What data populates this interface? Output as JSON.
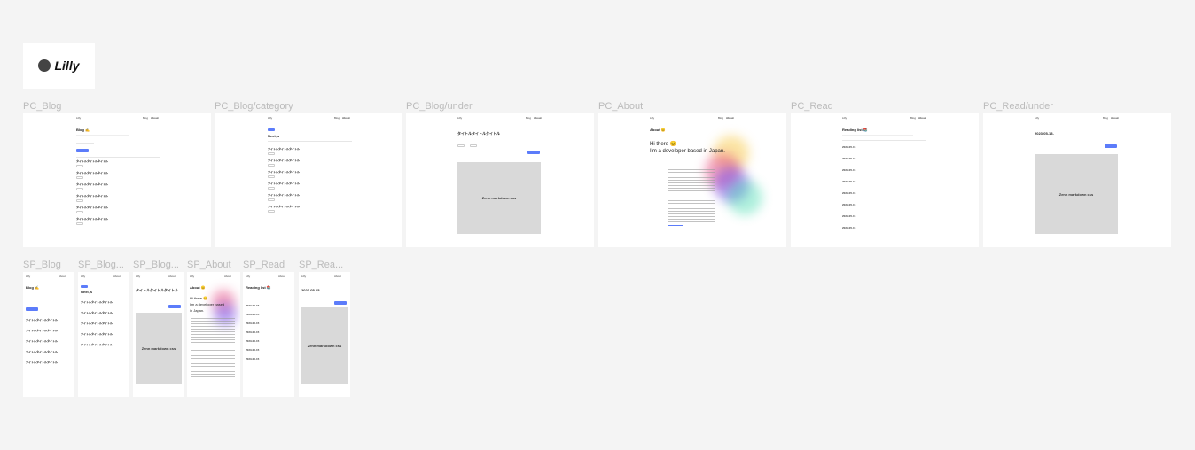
{
  "logo": {
    "text": "Lilly"
  },
  "frames": {
    "pc_blog": "PC_Blog",
    "pc_blog_category": "PC_Blog/category",
    "pc_blog_under": "PC_Blog/under",
    "pc_about": "PC_About",
    "pc_read": "PC_Read",
    "pc_read_under": "PC_Read/under",
    "sp_blog": "SP_Blog",
    "sp_blog_category": "SP_Blog...",
    "sp_blog_under": "SP_Blog...",
    "sp_about": "SP_About",
    "sp_read": "SP_Read",
    "sp_read_under": "SP_Rea..."
  },
  "site": {
    "brand": "Lilly",
    "nav_blog": "Blog",
    "nav_about": "About"
  },
  "blog": {
    "title": "Blog ✍",
    "category": "Next.js",
    "post_title": "タイトルタイトルタイトル",
    "under_title": "タイトルタイトルタイトル"
  },
  "about": {
    "title": "About 😊",
    "hi": "Hi there 😊",
    "tagline": "I'm a developer based in Japan.",
    "sp_tagline_1": "I'm a developer based",
    "sp_tagline_2": "in Japan."
  },
  "read": {
    "title": "Reading list 📚",
    "date": "2023-05-15",
    "under_date": "2023-05-15-"
  },
  "placeholder": "Zenn markdown css"
}
